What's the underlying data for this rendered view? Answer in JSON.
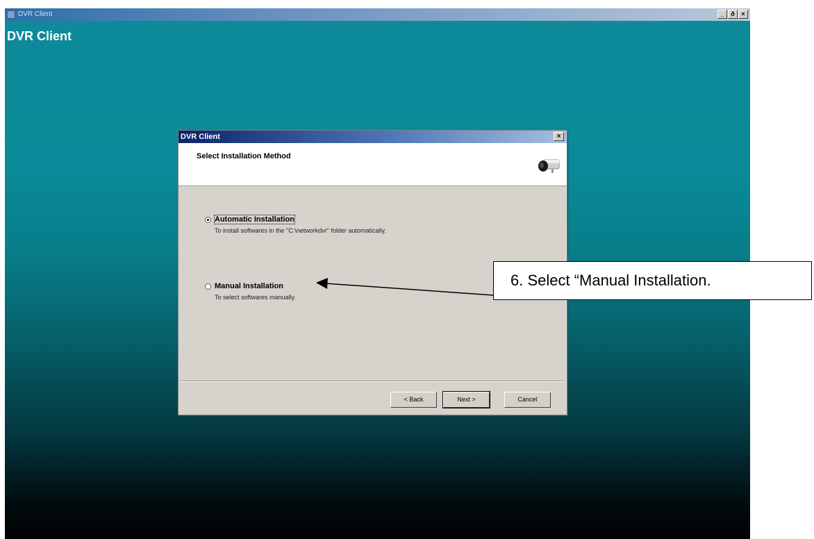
{
  "screen": {
    "window_title": "DVR Client",
    "heading": "DVR Client",
    "controls": {
      "minimize": "_",
      "maximize": "ð",
      "close": "×"
    }
  },
  "dialog": {
    "title": "DVR Client",
    "close": "×",
    "header": "Select Installation Method",
    "options": [
      {
        "label": "Automatic Installation",
        "description": "To install softwares in the \"C:\\networkdvr\" folder automatically.",
        "selected": true
      },
      {
        "label": "Manual Installation",
        "description": "To select softwares manually.",
        "selected": false
      }
    ],
    "buttons": {
      "back": "< Back",
      "next": "Next >",
      "cancel": "Cancel"
    }
  },
  "callout": {
    "text": "6. Select “Manual Installation."
  },
  "colors": {
    "desktop_top": "#0e8a9a",
    "desktop_bottom": "#000000",
    "dialog_face": "#d6d3cc",
    "titlebar": "#0a246a"
  }
}
